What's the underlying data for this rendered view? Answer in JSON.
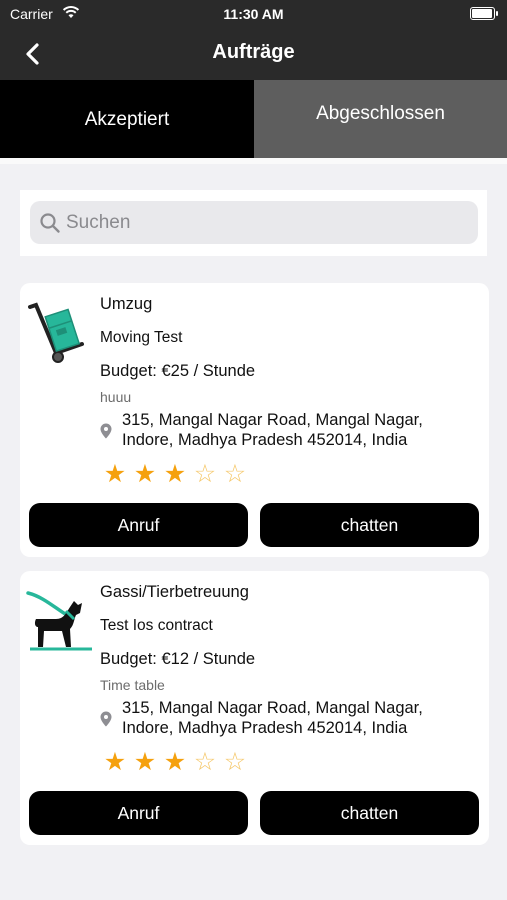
{
  "status_bar": {
    "carrier": "Carrier",
    "time": "11:30 AM",
    "battery_level": 1.0
  },
  "nav": {
    "title": "Aufträge",
    "back_icon": "chevron-left-icon"
  },
  "tabs": [
    {
      "label": "Akzeptiert",
      "selected": true
    },
    {
      "label": "Abgeschlossen",
      "selected": false
    }
  ],
  "search": {
    "placeholder": "Suchen",
    "icon": "search-icon"
  },
  "orders": [
    {
      "category": "Umzug",
      "icon": "hand-truck-icon",
      "title": "Moving Test",
      "budget": "Budget: €25  / Stunde",
      "note": "huuu",
      "address": "315, Mangal Nagar Road, Mangal Nagar, Indore, Madhya Pradesh 452014, India",
      "rating": 3,
      "rating_max": 5,
      "call_label": "Anruf",
      "chat_label": "chatten"
    },
    {
      "category": "Gassi/Tierbetreuung",
      "icon": "dog-leash-icon",
      "title": "Test Ios contract",
      "budget": "Budget: €12 / Stunde",
      "note": "Time table",
      "address": "315, Mangal Nagar Road, Mangal Nagar, Indore, Madhya Pradesh 452014, India",
      "rating": 3,
      "rating_max": 5,
      "call_label": "Anruf",
      "chat_label": "chatten"
    }
  ],
  "colors": {
    "bar_dark": "#2a2a2a",
    "tab_active": "#000000",
    "tab_inactive": "#5e5e5e",
    "star": "#f5a10e",
    "accent_teal": "#27b79a",
    "background": "#f1f1f4"
  }
}
